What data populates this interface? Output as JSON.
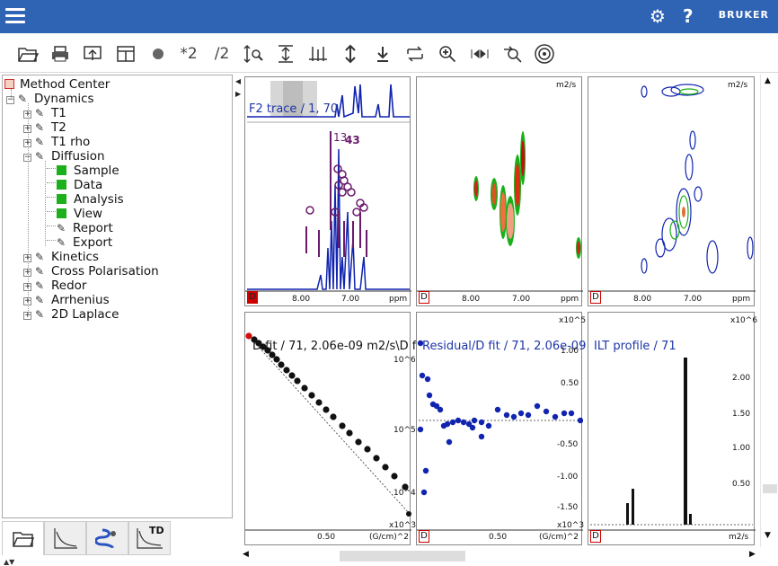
{
  "toolbar": {
    "scale_up_label": "*2",
    "scale_down_label": "/2"
  },
  "tree": {
    "root": "Method Center",
    "dynamics": "Dynamics",
    "items": [
      "T1",
      "T2",
      "T1 rho"
    ],
    "diffusion": "Diffusion",
    "diffusion_children_green": [
      "Sample",
      "Data",
      "Analysis",
      "View"
    ],
    "diffusion_children_pen": [
      "Report",
      "Export"
    ],
    "more": [
      "Kinetics",
      "Cross Polarisation",
      "Redor",
      "Arrhenius",
      "2D Laplace"
    ]
  },
  "tabs": {
    "td_label": "TD"
  },
  "panels": {
    "p1": {
      "title": "F2 trace / 1, 70",
      "x_ticks": [
        "8.00",
        "7.00"
      ],
      "unit": "ppm",
      "peak_labels": [
        "13",
        "43"
      ]
    },
    "p2": {
      "unit_top": "m2/s",
      "x_ticks": [
        "8.00",
        "7.00"
      ],
      "unit": "ppm"
    },
    "p3": {
      "unit_top": "m2/s",
      "x_ticks": [
        "8.00",
        "7.00"
      ],
      "unit": "ppm"
    },
    "p4": {
      "title": "D fit / 71,  2.06e-09 m2/s\\D f",
      "y_ticks": [
        "10^6",
        "10^5",
        "10^4"
      ],
      "x_tick": "0.50",
      "x_unit": "(G/cm)^2",
      "x_mult": "x10^3"
    },
    "p5": {
      "title": "Residual/D fit / 71,  2.06e-09",
      "y_mult": "x10^5",
      "y_ticks": [
        "1.00",
        "0.50",
        "-0.50",
        "-1.00",
        "-1.50"
      ],
      "x_tick": "0.50",
      "x_unit": "(G/cm)^2",
      "x_mult": "x10^3"
    },
    "p6": {
      "title": "ILT profile / 71",
      "y_mult": "x10^6",
      "y_ticks": [
        "2.00",
        "1.50",
        "1.00",
        "0.50"
      ],
      "x_unit": "m2/s"
    }
  },
  "colors": {
    "titlebar": "#2f63b4",
    "trace": "#1024b0",
    "markers": "#6a1a6a",
    "green": "#1db01d"
  }
}
